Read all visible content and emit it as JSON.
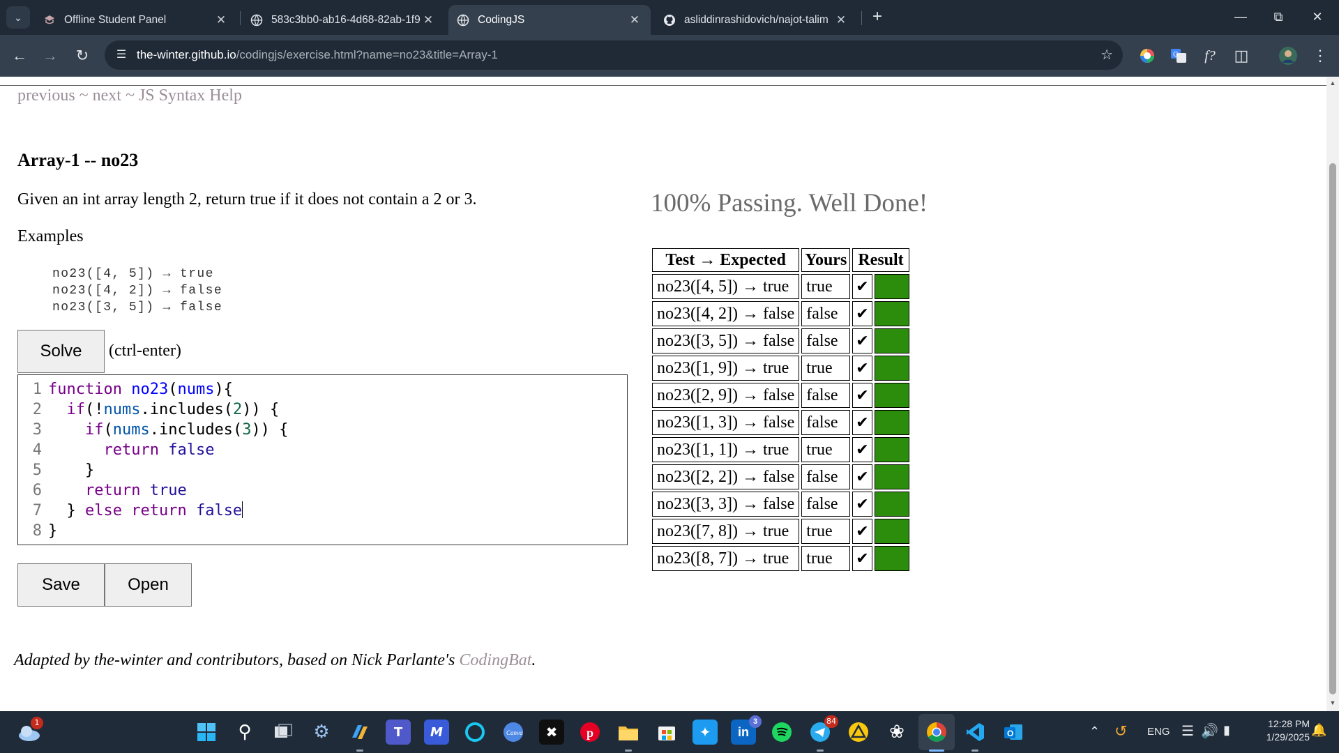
{
  "browser": {
    "tabs": [
      {
        "title": "Offline Student Panel",
        "active": false
      },
      {
        "title": "583c3bb0-ab16-4d68-82ab-1f9",
        "active": false
      },
      {
        "title": "CodingJS",
        "active": true
      },
      {
        "title": "asliddinrashidovich/najot-talim",
        "active": false
      }
    ],
    "url_host": "the-winter.github.io",
    "url_path": "/codingjs/exercise.html?name=no23&title=Array-1"
  },
  "page": {
    "nav": {
      "previous": "previous",
      "sep1": "~",
      "next": "next",
      "sep2": "~",
      "help": "JS Syntax Help"
    },
    "exercise_title": "Array-1 -- no23",
    "description": "Given an int array length 2, return true if it does not contain a 2 or 3.",
    "examples_heading": "Examples",
    "examples": [
      "no23([4, 5]) → true",
      "no23([4, 2]) → false",
      "no23([3, 5]) → false"
    ],
    "solve_label": "Solve",
    "solve_hint": "(ctrl-enter)",
    "line_numbers": [
      "1",
      "2",
      "3",
      "4",
      "5",
      "6",
      "7",
      "8"
    ],
    "save_label": "Save",
    "open_label": "Open",
    "footer_text": "Adapted by the-winter and contributors, based on Nick Parlante's",
    "footer_link": "CodingBat",
    "footer_end": ".",
    "pass_message": "100% Passing. Well Done!",
    "results": {
      "headers": [
        "Test → Expected",
        "Yours",
        "Result"
      ],
      "rows": [
        {
          "test": "no23([4, 5]) → true",
          "yours": "true",
          "check": "✔"
        },
        {
          "test": "no23([4, 2]) → false",
          "yours": "false",
          "check": "✔"
        },
        {
          "test": "no23([3, 5]) → false",
          "yours": "false",
          "check": "✔"
        },
        {
          "test": "no23([1, 9]) → true",
          "yours": "true",
          "check": "✔"
        },
        {
          "test": "no23([2, 9]) → false",
          "yours": "false",
          "check": "✔"
        },
        {
          "test": "no23([1, 3]) → false",
          "yours": "false",
          "check": "✔"
        },
        {
          "test": "no23([1, 1]) → true",
          "yours": "true",
          "check": "✔"
        },
        {
          "test": "no23([2, 2]) → false",
          "yours": "false",
          "check": "✔"
        },
        {
          "test": "no23([3, 3]) → false",
          "yours": "false",
          "check": "✔"
        },
        {
          "test": "no23([7, 8]) → true",
          "yours": "true",
          "check": "✔"
        },
        {
          "test": "no23([8, 7]) → true",
          "yours": "true",
          "check": "✔"
        }
      ]
    }
  },
  "code_tokens": {
    "function_kw": "function",
    "fn_name": "no23",
    "param": "nums",
    "if_kw": "if",
    "bang": "!",
    "includes": "includes",
    "two": "2",
    "three": "3",
    "return_kw": "return",
    "false_kw": "false",
    "true_kw": "true",
    "else_kw": "else"
  },
  "taskbar": {
    "notification_badge": "1",
    "linkedin_badge": "3",
    "telegram_badge": "84",
    "lang": "ENG",
    "time": "12:28 PM",
    "date": "1/29/2025"
  },
  "colors": {
    "pass_green": "#2c8c0c",
    "link_muted": "#9b8e98",
    "chrome_dark": "#202a37"
  }
}
